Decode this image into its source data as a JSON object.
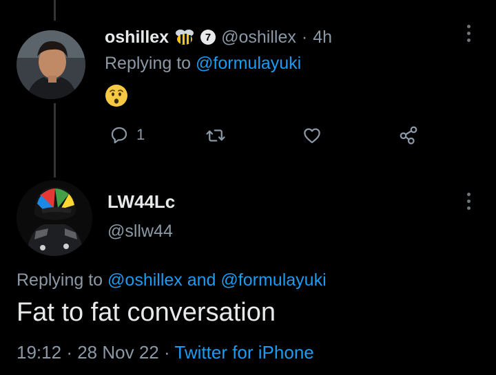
{
  "tweet1": {
    "display_name": "oshillex",
    "badge": "7",
    "handle": "@oshillex",
    "separator": "·",
    "time": "4h",
    "replying_prefix": "Replying to",
    "replying_to": "@formulayuki",
    "emoji": "hushed-face-emoji",
    "actions": {
      "reply_icon": "reply-icon",
      "reply_count": "1",
      "retweet_icon": "retweet-icon",
      "like_icon": "heart-icon",
      "share_icon": "share-icon"
    }
  },
  "tweet2": {
    "display_name": "LW44Lc",
    "handle": "@sllw44",
    "replying_prefix": "Replying to",
    "replying_to_1": "@oshillex",
    "replying_and": "and",
    "replying_to_2": "@formulayuki",
    "text": "Fat to fat conversation",
    "time": "19:12",
    "separator": "·",
    "date": "28 Nov 22",
    "source": "Twitter for iPhone"
  },
  "colors": {
    "background": "#000000",
    "primary_text": "#e7e9ea",
    "secondary_text": "#8b98a5",
    "link": "#1d9bf0",
    "thread_line": "#333639"
  }
}
